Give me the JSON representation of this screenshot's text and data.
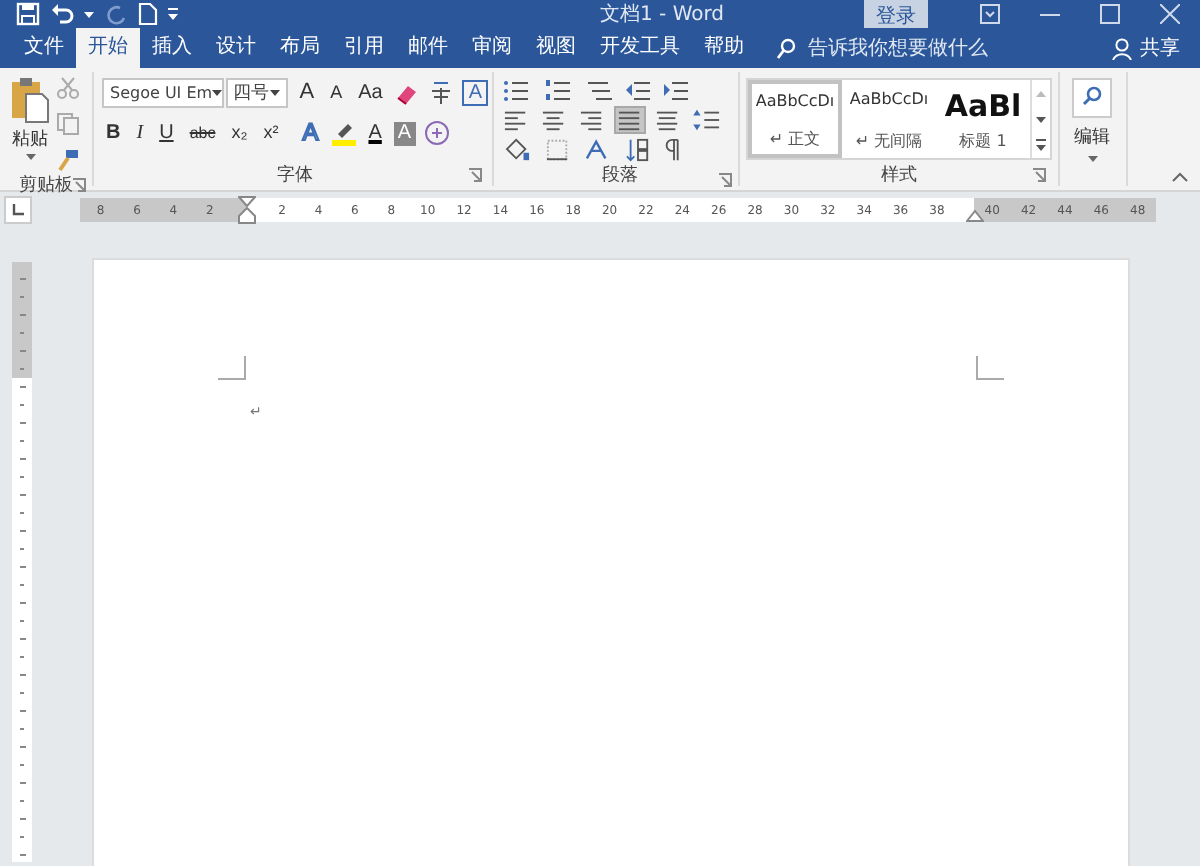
{
  "window": {
    "title": "文档1 - Word",
    "login_button": "登录"
  },
  "tabs": [
    {
      "label": "文件",
      "selected": false
    },
    {
      "label": "开始",
      "selected": true
    },
    {
      "label": "插入",
      "selected": false
    },
    {
      "label": "设计",
      "selected": false
    },
    {
      "label": "布局",
      "selected": false
    },
    {
      "label": "引用",
      "selected": false
    },
    {
      "label": "邮件",
      "selected": false
    },
    {
      "label": "审阅",
      "selected": false
    },
    {
      "label": "视图",
      "selected": false
    },
    {
      "label": "开发工具",
      "selected": false
    },
    {
      "label": "帮助",
      "selected": false
    }
  ],
  "tell_me": {
    "placeholder": "告诉我你想要做什么"
  },
  "share_button": "共享",
  "ribbon": {
    "clipboard": {
      "paste_button": "粘贴",
      "label": "剪贴板"
    },
    "font": {
      "font_name": "Segoe UI Em",
      "font_size": "四号",
      "label": "字体",
      "row_1": [
        {
          "kind": "grow",
          "text": "A"
        },
        {
          "kind": "shrink",
          "text": "A"
        },
        {
          "kind": "case",
          "text": "Aa"
        },
        {
          "kind": "clear"
        },
        {
          "kind": "phonetic"
        },
        {
          "kind": "border",
          "text": "A"
        }
      ],
      "row_2": [
        {
          "kind": "bold",
          "text": "B"
        },
        {
          "kind": "italic",
          "text": "I"
        },
        {
          "kind": "underline",
          "text": "U"
        },
        {
          "kind": "strike",
          "text": "abc"
        },
        {
          "kind": "sub",
          "text": "x₂"
        },
        {
          "kind": "sup",
          "text": "x²"
        },
        {
          "kind": "effects",
          "text": "A"
        },
        {
          "kind": "highlight"
        },
        {
          "kind": "color",
          "text": "A"
        },
        {
          "kind": "shading",
          "text": "A"
        },
        {
          "kind": "enclose"
        }
      ]
    },
    "paragraph": {
      "label": "段落",
      "alignments": [
        {
          "selected": false
        },
        {
          "selected": false
        },
        {
          "selected": false
        },
        {
          "selected": true
        },
        {
          "selected": false
        }
      ]
    },
    "styles": {
      "label": "样式",
      "items": [
        {
          "preview": "AaBbCcDı",
          "name": "↵ 正文",
          "kind": "normal",
          "selected": true
        },
        {
          "preview": "AaBbCcDı",
          "name": "↵ 无间隔",
          "kind": "normal",
          "selected": false
        },
        {
          "preview": "AaBl",
          "name": "标题 1",
          "kind": "heading",
          "selected": false
        }
      ]
    },
    "editing": {
      "label": "编辑"
    }
  },
  "ruler": {
    "left_numbers": [
      "8",
      "6",
      "4",
      "2"
    ],
    "numbers": [
      "2",
      "4",
      "6",
      "8",
      "10",
      "12",
      "14",
      "16",
      "18",
      "20",
      "22",
      "24",
      "26",
      "28",
      "30",
      "32",
      "34",
      "36",
      "38"
    ],
    "right_numbers": [
      "40",
      "42",
      "44",
      "46",
      "48"
    ]
  },
  "document": {
    "paragraph_mark": "↵"
  }
}
